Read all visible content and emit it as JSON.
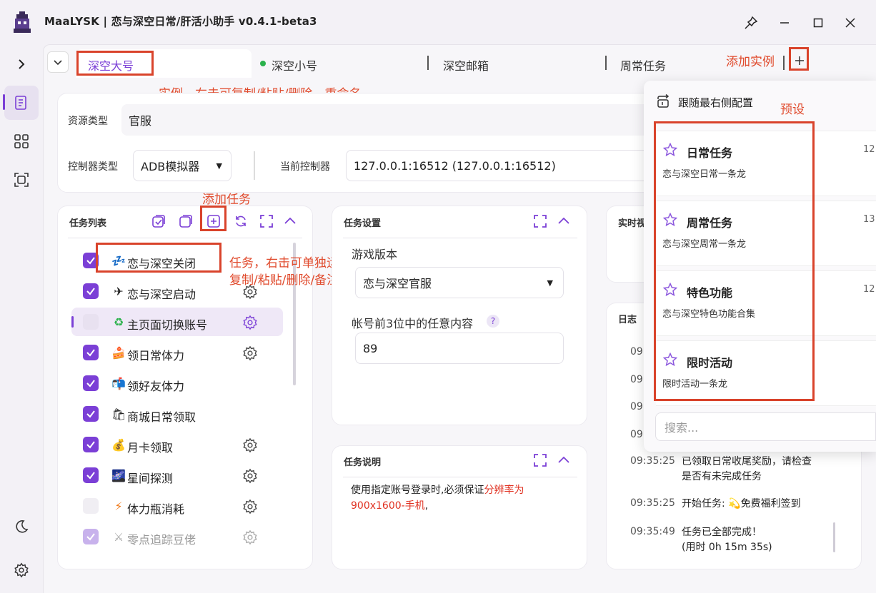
{
  "app": {
    "title": "MaaLYSK | 恋与深空日常/肝活小助手 v0.4.1-beta3"
  },
  "tabs": [
    {
      "label": "深空大号"
    },
    {
      "label": "深空小号"
    },
    {
      "label": "深空邮箱"
    },
    {
      "label": "周常任务"
    }
  ],
  "annotations": {
    "add_instance": "添加实例",
    "instance_note": "实例，右击可复制/粘贴/删除、重命名",
    "add_task": "添加任务",
    "task_note_line1": "任务，右击可单独运行/从此运行/",
    "task_note_line2": "复制/粘贴/删除/备注",
    "preset": "预设"
  },
  "resource": {
    "label": "资源类型",
    "value": "官服"
  },
  "controller": {
    "type_label": "控制器类型",
    "type_value": "ADB模拟器",
    "current_label": "当前控制器",
    "current_value": "127.0.0.1:16512 (127.0.0.1:16512)"
  },
  "task_list": {
    "title": "任务列表",
    "items": [
      {
        "name": "恋与深空关闭",
        "icon": "💤",
        "checked": true
      },
      {
        "name": "恋与深空启动",
        "icon": "✈",
        "checked": true
      },
      {
        "name": "主页面切换账号",
        "icon": "♻",
        "checked": false
      },
      {
        "name": "领日常体力",
        "icon": "🍰",
        "checked": true
      },
      {
        "name": "领好友体力",
        "icon": "📬",
        "checked": true
      },
      {
        "name": "商城日常领取",
        "icon": "🛍",
        "checked": true
      },
      {
        "name": "月卡领取",
        "icon": "💰",
        "checked": true
      },
      {
        "name": "星间探测",
        "icon": "🌌",
        "checked": true
      },
      {
        "name": "体力瓶消耗",
        "icon": "⚡",
        "checked": false
      },
      {
        "name": "零点追踪豆佬",
        "icon": "⚔",
        "checked": true
      }
    ]
  },
  "task_settings": {
    "title": "任务设置",
    "game_version_label": "游戏版本",
    "game_version_value": "恋与深空官服",
    "account_label": "帐号前3位中的任意内容",
    "help_mark": "?",
    "account_value": "89"
  },
  "task_desc": {
    "title": "任务说明",
    "text_normal": "使用指定账号登录时,必须保证",
    "text_red": "分辨率为900x1600-手机",
    "text_tail": ","
  },
  "realtime": {
    "title": "实时视"
  },
  "log": {
    "title": "日志",
    "partial_times": [
      "09:",
      "09:",
      "09:",
      "09:"
    ],
    "entries": [
      {
        "time": "09:35:25",
        "line1": "已领取日常收尾奖励，请检查",
        "line2": "是否有未完成任务"
      },
      {
        "time": "09:35:25",
        "line1": "开始任务: ",
        "icon": "💫",
        "line1b": "免费福利签到"
      },
      {
        "time": "09:35:49",
        "line1": "任务已全部完成！",
        "line2": "(用时 0h 15m 35s)"
      }
    ]
  },
  "presets": {
    "header": "跟随最右侧配置",
    "items": [
      {
        "name": "日常任务",
        "desc": "恋与深空日常一条龙",
        "num": "12"
      },
      {
        "name": "周常任务",
        "desc": "恋与深空周常一条龙",
        "num": "13"
      },
      {
        "name": "特色功能",
        "desc": "恋与深空特色功能合集",
        "num": "12"
      },
      {
        "name": "限时活动",
        "desc": "限时活动一条龙",
        "num": ""
      }
    ],
    "search_placeholder": "搜索..."
  },
  "colors": {
    "accent": "#7b3fd6",
    "annotation": "#d9432b",
    "online": "#2bb24c"
  }
}
